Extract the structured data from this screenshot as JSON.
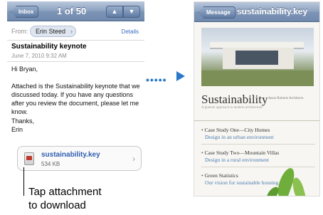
{
  "mail": {
    "back_label": "Inbox",
    "counter": "1 of 50",
    "up_symbol": "▲",
    "down_symbol": "▼",
    "from_label": "From:",
    "sender": "Erin Steed",
    "details_label": "Details",
    "subject": "Sustainability keynote",
    "date": "June 7, 2010 9:32 AM",
    "greeting": "Hi Bryan,",
    "body": "Attached is the Sustainability keynote that we discussed today. If you have any questions after you review the document, please let me know.",
    "signoff": "Thanks,",
    "signature": "Erin",
    "attachment": {
      "name": "sustainability.key",
      "size": "534 KB"
    }
  },
  "preview": {
    "back_label": "Message",
    "title": "sustainability.key",
    "doc_title": "Sustainability",
    "doc_author": "Jason Roberts Architects",
    "doc_subtitle": "A greener approach to modern architecture",
    "items": [
      {
        "heading": "Case Study One—City Homes",
        "sub": "Design in an urban environment"
      },
      {
        "heading": "Case Study Two—Mountain Villas",
        "sub": "Design in a rural environment"
      },
      {
        "heading": "Green Statistics",
        "sub": "Our vision for sustainable housing"
      }
    ]
  },
  "callout": {
    "line1": "Tap attachment",
    "line2": "to download"
  },
  "colors": {
    "navbar": "#7d95b7",
    "link_blue": "#2f5eae",
    "arrow_blue": "#2b78c8"
  },
  "icons": [
    "back-arrow-icon",
    "up-arrow-icon",
    "down-arrow-icon",
    "chevron-right-icon",
    "keynote-file-icon"
  ]
}
